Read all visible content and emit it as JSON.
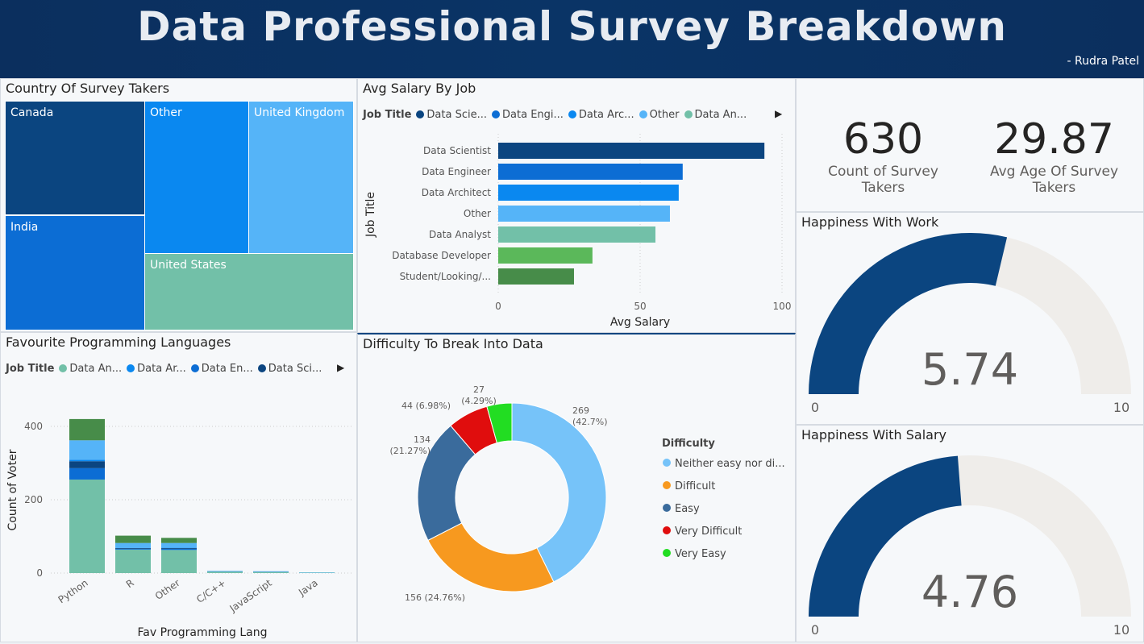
{
  "header": {
    "title": "Data Professional Survey Breakdown",
    "author": "-  Rudra Patel"
  },
  "country": {
    "title": "Country Of Survey Takers",
    "items": [
      {
        "label": "Canada",
        "color": "#0b4580"
      },
      {
        "label": "India",
        "color": "#0c6dd4"
      },
      {
        "label": "Other",
        "color": "#0a88f0"
      },
      {
        "label": "United Kingdom",
        "color": "#55b4f8"
      },
      {
        "label": "United States",
        "color": "#72c0a8"
      }
    ]
  },
  "salary": {
    "title": "Avg Salary By Job",
    "legend_title": "Job Title",
    "legend": [
      {
        "label": "Data Scie...",
        "color": "#0b4580"
      },
      {
        "label": "Data Engi...",
        "color": "#0c6dd4"
      },
      {
        "label": "Data Arc...",
        "color": "#0a88f0"
      },
      {
        "label": "Other",
        "color": "#55b4f8"
      },
      {
        "label": "Data An...",
        "color": "#72c0a8"
      }
    ]
  },
  "languages": {
    "title": "Favourite Programming Languages",
    "legend_title": "Job Title",
    "legend": [
      {
        "label": "Data An...",
        "color": "#72c0a8"
      },
      {
        "label": "Data Ar...",
        "color": "#0a88f0"
      },
      {
        "label": "Data En...",
        "color": "#0c6dd4"
      },
      {
        "label": "Data Sci...",
        "color": "#0b4580"
      }
    ]
  },
  "difficulty": {
    "title": "Difficulty To Break Into Data",
    "legend_title": "Difficulty"
  },
  "kpis": [
    {
      "value": "630",
      "label": "Count of Survey Takers"
    },
    {
      "value": "29.87",
      "label": "Avg Age Of  Survey Takers"
    }
  ],
  "gauges": [
    {
      "title": "Happiness With Work",
      "value": 5.74,
      "value_label": "5.74",
      "min": "0",
      "max": "10"
    },
    {
      "title": "Happiness With Salary",
      "value": 4.76,
      "value_label": "4.76",
      "min": "0",
      "max": "10"
    }
  ],
  "chart_data": [
    {
      "type": "bar",
      "orientation": "horizontal",
      "title": "Avg Salary By Job",
      "xlabel": "Avg Salary",
      "ylabel": "Job Title",
      "xlim": [
        0,
        100
      ],
      "xticks": [
        "0",
        "50",
        "100"
      ],
      "categories": [
        "Data Scientist",
        "Data Engineer",
        "Data Architect",
        "Other",
        "Data Analyst",
        "Database Developer",
        "Student/Looking/..."
      ],
      "values": [
        93.8,
        65,
        63.6,
        60.5,
        55.4,
        33.2,
        26.7
      ],
      "colors": [
        "#0b4580",
        "#0c6dd4",
        "#0a88f0",
        "#55b4f8",
        "#72c0a8",
        "#5bb85a",
        "#478c49"
      ]
    },
    {
      "type": "bar",
      "stacked": true,
      "title": "Favourite Programming Languages",
      "xlabel": "Fav Programming Lang",
      "ylabel": "Count of Voter",
      "ylim": [
        0,
        430
      ],
      "yticks": [
        "0",
        "200",
        "400"
      ],
      "categories": [
        "Python",
        "R",
        "Other",
        "C/C++",
        "JavaScript",
        "Java"
      ],
      "series": [
        {
          "name": "Data Analyst",
          "color": "#72c0a8",
          "values": [
            255,
            64,
            63,
            4,
            3,
            1
          ]
        },
        {
          "name": "Data Engineer",
          "color": "#0c6dd4",
          "values": [
            31,
            2,
            3,
            1,
            1,
            0
          ]
        },
        {
          "name": "Data Scientist",
          "color": "#0b4580",
          "values": [
            19,
            2,
            2,
            0,
            0,
            0
          ]
        },
        {
          "name": "Data Architect",
          "color": "#0a88f0",
          "values": [
            4,
            0,
            1,
            0,
            0,
            0
          ]
        },
        {
          "name": "Other",
          "color": "#55b4f8",
          "values": [
            53,
            14,
            13,
            1,
            1,
            1
          ]
        },
        {
          "name": "Student/Looking/...",
          "color": "#478c49",
          "values": [
            58,
            20,
            14,
            0,
            0,
            0
          ]
        }
      ]
    },
    {
      "type": "pie",
      "donut": true,
      "title": "Difficulty To Break Into Data",
      "legend_title": "Difficulty",
      "slices": [
        {
          "name": "Neither easy nor di...",
          "value": 269,
          "label": "269\n(42.7%)",
          "color": "#76c3f9"
        },
        {
          "name": "Difficult",
          "value": 156,
          "label": "156 (24.76%)",
          "color": "#f7991f"
        },
        {
          "name": "Easy",
          "value": 134,
          "label": "134\n(21.27%)",
          "color": "#3a6b9c"
        },
        {
          "name": "Very Difficult",
          "value": 44,
          "label": "44 (6.98%)",
          "color": "#e00d0d"
        },
        {
          "name": "Very Easy",
          "value": 27,
          "label": "27\n(4.29%)",
          "color": "#22dd22"
        }
      ]
    }
  ]
}
